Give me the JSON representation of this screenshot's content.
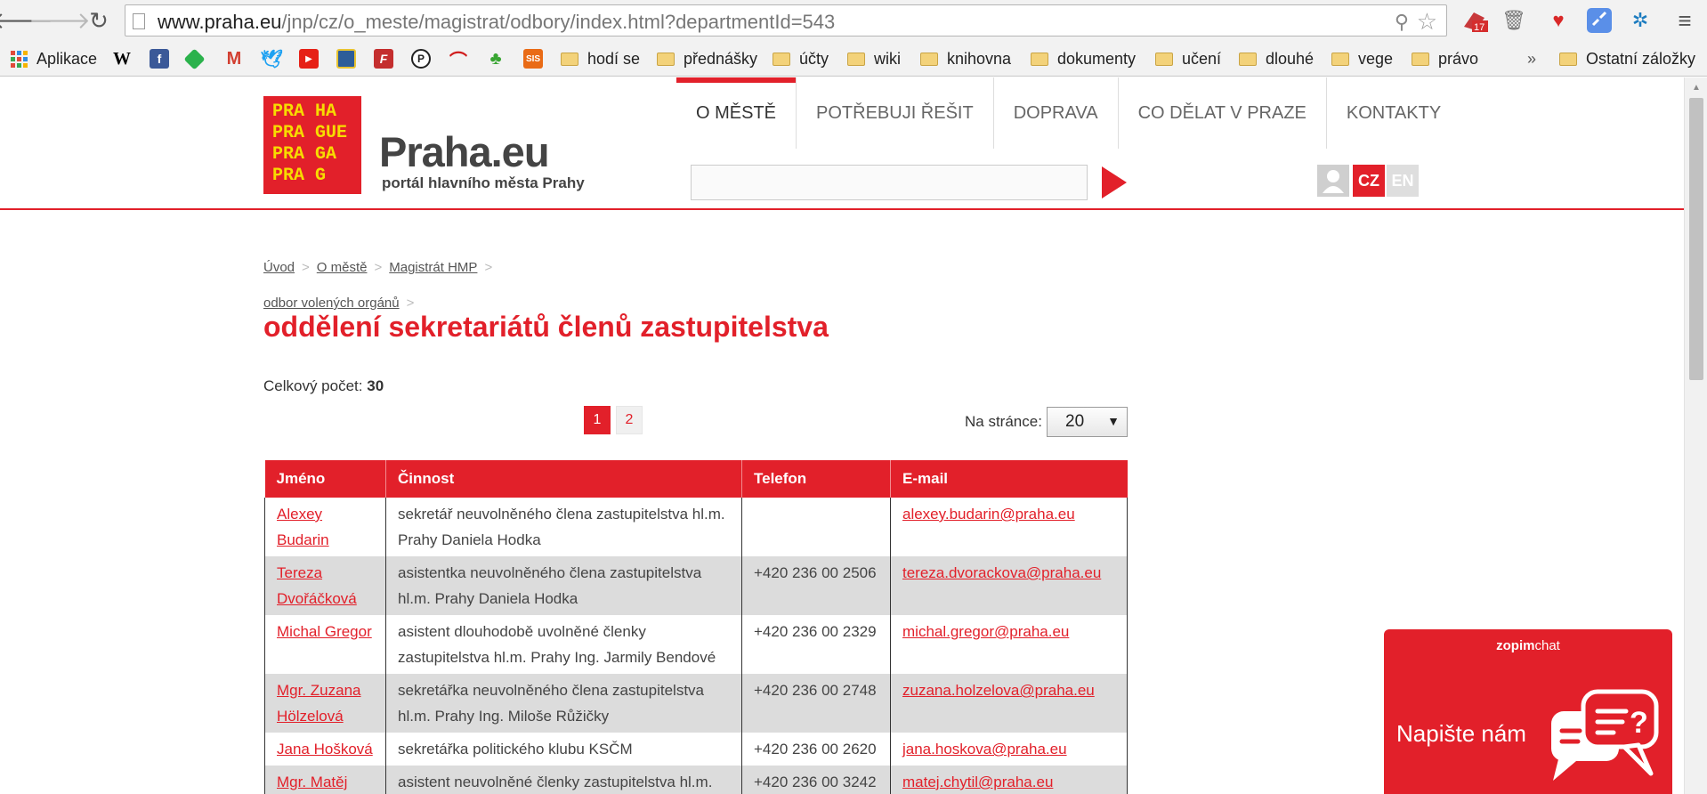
{
  "browser": {
    "url_host": "www.praha.eu",
    "url_path": "/jnp/cz/o_meste/magistrat/odbory/index.html?departmentId=543",
    "extension_badge": "17",
    "bookmarks": [
      {
        "label": "Aplikace",
        "type": "apps"
      },
      {
        "label": "hodí se",
        "type": "folder"
      },
      {
        "label": "přednášky",
        "type": "folder"
      },
      {
        "label": "účty",
        "type": "folder"
      },
      {
        "label": "wiki",
        "type": "folder"
      },
      {
        "label": "knihovna",
        "type": "folder"
      },
      {
        "label": "dokumenty",
        "type": "folder"
      },
      {
        "label": "učení",
        "type": "folder"
      },
      {
        "label": "dlouhé",
        "type": "folder"
      },
      {
        "label": "vege",
        "type": "folder"
      },
      {
        "label": "právo",
        "type": "folder"
      },
      {
        "label": "Ostatní záložky",
        "type": "folder"
      }
    ],
    "bookmark_icons": [
      "wikipedia-icon",
      "facebook-icon",
      "feedly-icon",
      "gmail-icon",
      "twitter-icon",
      "youtube-icon",
      "news-icon",
      "pinboard-icon",
      "pirate-icon",
      "arc-icon",
      "frog-icon",
      "sis-icon"
    ],
    "overflow_chevron": "»"
  },
  "site": {
    "logo_lines": "PRA HA\nPRA GUE\nPRA GA\nPRA G",
    "title": "Praha.eu",
    "subtitle": "portál hlavního města Prahy",
    "nav": [
      "O MĚSTĚ",
      "POTŘEBUJI ŘEŠIT",
      "DOPRAVA",
      "CO DĚLAT V PRAZE",
      "KONTAKTY"
    ],
    "search_placeholder": "",
    "lang_cz": "CZ",
    "lang_en": "EN"
  },
  "breadcrumb": {
    "items": [
      "Úvod",
      "O městě",
      "Magistrát HMP",
      "odbor volených orgánů"
    ],
    "separator": ">"
  },
  "page": {
    "title": "oddělení sekretariátů členů zastupitelstva",
    "total_label": "Celkový počet:",
    "total_value": "30",
    "pages": [
      "1",
      "2"
    ],
    "per_page_label": "Na stránce:",
    "per_page_value": "20"
  },
  "table": {
    "headers": [
      "Jméno",
      "Činnost",
      "Telefon",
      "E-mail"
    ],
    "rows": [
      {
        "name": "Alexey Budarin",
        "activity": "sekretář neuvolněného člena zastupitelstva hl.m. Prahy Daniela Hodka",
        "phone": "",
        "email": "alexey.budarin@praha.eu"
      },
      {
        "name": "Tereza Dvořáčková",
        "activity": "asistentka neuvolněného člena zastupitelstva hl.m. Prahy Daniela Hodka",
        "phone": "+420 236 00 2506",
        "email": "tereza.dvorackova@praha.eu"
      },
      {
        "name": "Michal Gregor",
        "activity": "asistent dlouhodobě uvolněné členky zastupitelstva hl.m. Prahy Ing. Jarmily Bendové",
        "phone": "+420 236 00 2329",
        "email": "michal.gregor@praha.eu"
      },
      {
        "name": "Mgr. Zuzana Hölzelová",
        "activity": "sekretářka neuvolněného člena zastupitelstva hl.m. Prahy Ing. Miloše Růžičky",
        "phone": "+420 236 00 2748",
        "email": "zuzana.holzelova@praha.eu"
      },
      {
        "name": "Jana Hošková",
        "activity": "sekretářka politického klubu KSČM",
        "phone": "+420 236 00 2620",
        "email": "jana.hoskova@praha.eu"
      },
      {
        "name": "Mgr. Matěj Chytil",
        "activity": "asistent neuvolněné členky zastupitelstva hl.m. Prahy Mgr. Petry Kolínské",
        "phone": "+420 236 00 3242",
        "email": "matej.chytil@praha.eu"
      }
    ]
  },
  "chat": {
    "brand_bold": "zopim",
    "brand_light": "chat",
    "cta": "Napište nám"
  },
  "colors": {
    "accent": "#e2202a",
    "logo_yellow": "#f7dc00",
    "row_alt": "#dcdcdc"
  }
}
